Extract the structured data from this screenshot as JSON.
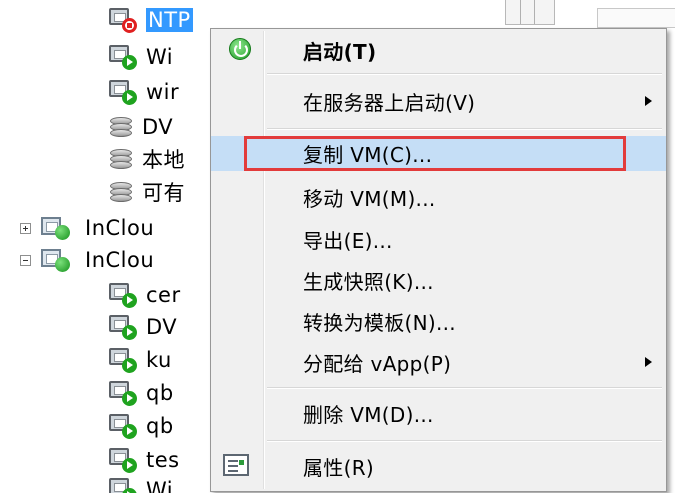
{
  "tree": {
    "items": [
      {
        "label": "NTP",
        "icon": "vm-stopped-icon",
        "selected": true
      },
      {
        "label": "Wi",
        "icon": "vm-running-icon"
      },
      {
        "label": "wir",
        "icon": "vm-running-icon"
      },
      {
        "label": "DV",
        "icon": "datastore-icon"
      },
      {
        "label": "本地",
        "icon": "datastore-icon"
      },
      {
        "label": "可有",
        "icon": "datastore-icon"
      },
      {
        "label": "InClou",
        "icon": "resource-pool-icon",
        "expander": "+"
      },
      {
        "label": "InClou",
        "icon": "resource-pool-icon",
        "expander": "-"
      },
      {
        "label": "cer",
        "icon": "vm-running-icon"
      },
      {
        "label": "DV",
        "icon": "vm-running-icon"
      },
      {
        "label": "ku",
        "icon": "vm-running-icon"
      },
      {
        "label": "qb",
        "icon": "vm-running-icon"
      },
      {
        "label": "qb",
        "icon": "vm-running-icon"
      },
      {
        "label": "tes",
        "icon": "vm-running-icon"
      },
      {
        "label": "Wi",
        "icon": "vm-running-icon"
      }
    ]
  },
  "context_menu": {
    "items": [
      {
        "label": "启动(T)",
        "icon": "power-on-icon",
        "bold": true
      },
      {
        "label": "在服务器上启动(V)",
        "submenu": true
      },
      {
        "label": "复制 VM(C)...",
        "highlighted": true
      },
      {
        "label": "移动 VM(M)..."
      },
      {
        "label": "导出(E)..."
      },
      {
        "label": "生成快照(K)..."
      },
      {
        "label": "转换为模板(N)..."
      },
      {
        "label": "分配给 vApp(P)",
        "submenu": true
      },
      {
        "label": "删除 VM(D)..."
      },
      {
        "label": "属性(R)",
        "icon": "properties-icon"
      }
    ]
  },
  "colors": {
    "highlight": "#c5def6",
    "annotation_box": "#e23b3b",
    "selection": "#3399ff"
  }
}
